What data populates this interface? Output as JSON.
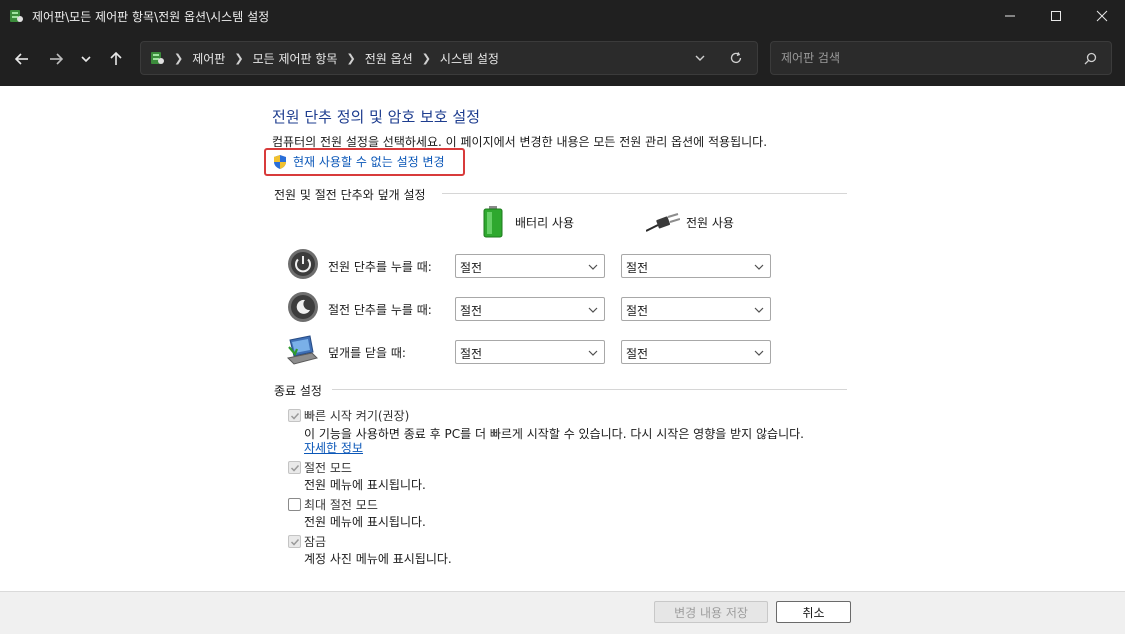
{
  "window": {
    "title": "제어판\\모든 제어판 항목\\전원 옵션\\시스템 설정"
  },
  "address": {
    "crumbs": [
      "제어판",
      "모든 제어판 항목",
      "전원 옵션",
      "시스템 설정"
    ]
  },
  "search": {
    "placeholder": "제어판 검색"
  },
  "page": {
    "title": "전원 단추 정의 및 암호 보호 설정",
    "description": "컴퓨터의 전원 설정을 선택하세요. 이 페이지에서 변경한 내용은 모든 전원 관리 옵션에 적용됩니다.",
    "change_link": "현재 사용할 수 없는 설정 변경"
  },
  "power_section": {
    "heading": "전원 및 절전 단추와 덮개 설정",
    "col_battery": "배터리 사용",
    "col_plugged": "전원 사용",
    "rows": [
      {
        "label": "전원 단추를 누를 때:",
        "battery": "절전",
        "plugged": "절전"
      },
      {
        "label": "절전 단추를 누를 때:",
        "battery": "절전",
        "plugged": "절전"
      },
      {
        "label": "덮개를 닫을 때:",
        "battery": "절전",
        "plugged": "절전"
      }
    ]
  },
  "shutdown_section": {
    "heading": "종료 설정",
    "options": [
      {
        "label": "빠른 시작 켜기(권장)",
        "desc": "이 기능을 사용하면 종료 후 PC를 더 빠르게 시작할 수 있습니다. 다시 시작은 영향을 받지 않습니다.",
        "checked": true,
        "link": "자세한 정보"
      },
      {
        "label": "절전 모드",
        "desc": "전원 메뉴에 표시됩니다.",
        "checked": true
      },
      {
        "label": "최대 절전 모드",
        "desc": "전원 메뉴에 표시됩니다.",
        "checked": false
      },
      {
        "label": "잠금",
        "desc": "계정 사진 메뉴에 표시됩니다.",
        "checked": true
      }
    ]
  },
  "footer": {
    "save_label": "변경 내용 저장",
    "cancel_label": "취소"
  }
}
